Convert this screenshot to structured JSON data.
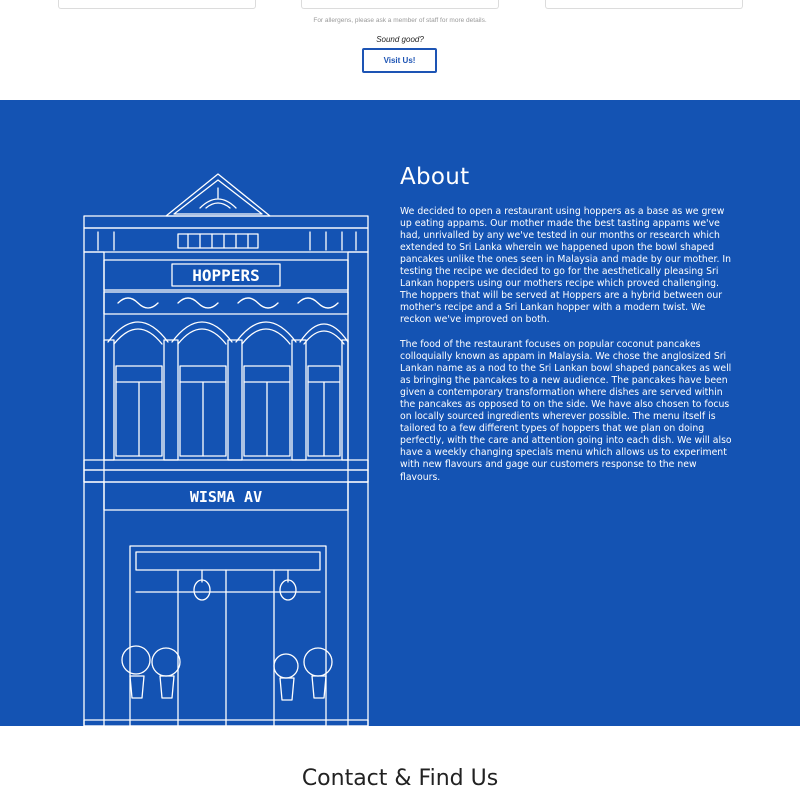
{
  "menu_section": {
    "allergens_note": "For allergens, please ask a member of staff for more details.",
    "prompt": "Sound good?",
    "visit_button": "Visit Us!"
  },
  "about": {
    "heading": "About",
    "paragraph_1": "We decided to open a restaurant using hoppers as a base as we grew up eating appams. Our mother made the best tasting appams we've had, unrivalled by any we've tested in our months or research which extended to Sri Lanka wherein we happened upon the bowl shaped pancakes unlike the ones seen in Malaysia and made by our mother. In testing the recipe we decided to go for the aesthetically pleasing Sri Lankan hoppers using our mothers recipe which proved challenging. The hoppers that will be served at Hoppers are a hybrid between our mother's recipe and a Sri Lankan hopper with a modern twist. We reckon we've improved on both.",
    "paragraph_2": "The food of the restaurant focuses on popular coconut pancakes colloquially known as appam in Malaysia. We chose the anglosized Sri Lankan name as a nod to the Sri Lankan bowl shaped pancakes as well as bringing the pancakes to a new audience. The pancakes have been given a contemporary transformation where dishes are served within the pancakes as opposed to on the side. We have also chosen to focus on locally sourced ingredients wherever possible. The menu itself is tailored to a few different types of hoppers that we plan on doing perfectly, with the care and attention going into each dish. We will also have a weekly changing specials menu which allows us to experiment with new flavours and gage our customers response to the new flavours.",
    "illustration": {
      "sign_top": "HOPPERS",
      "sign_bottom": "WISMA AV"
    }
  },
  "contact": {
    "heading": "Contact & Find Us"
  },
  "colors": {
    "brand_blue": "#1453b3",
    "button_border": "#1d54b4"
  }
}
